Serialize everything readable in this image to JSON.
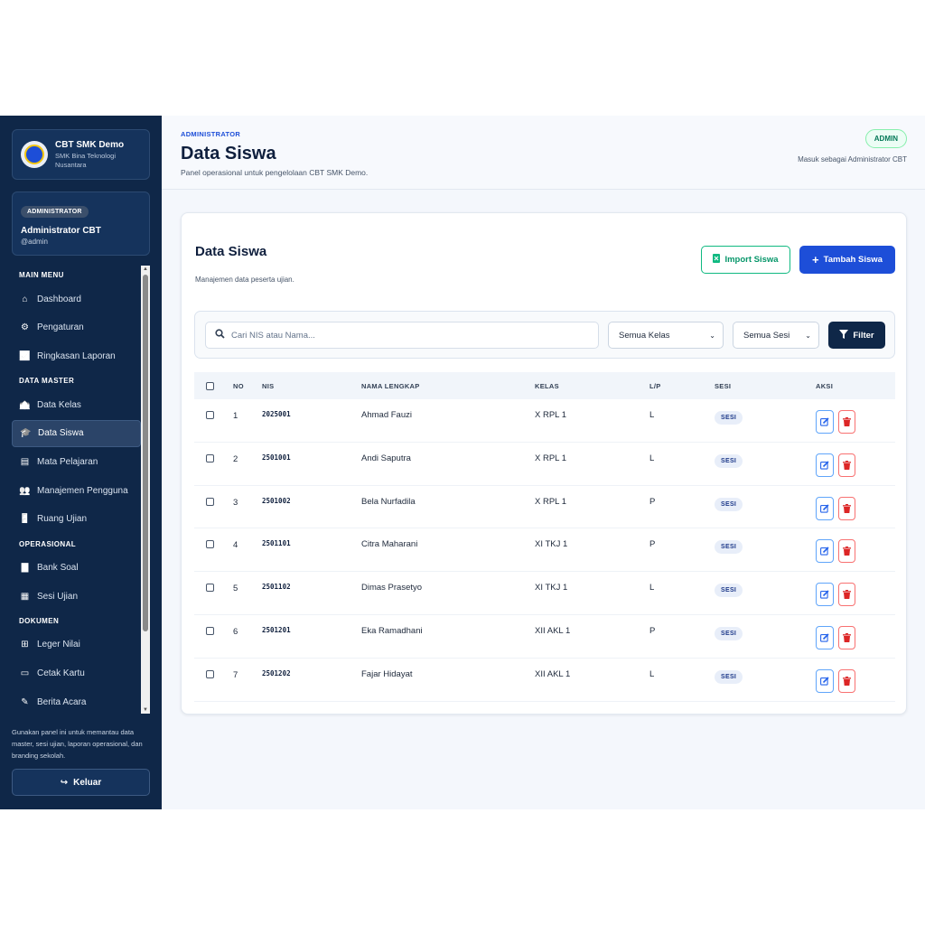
{
  "colors": {
    "sidebar_bg": "#0f2748",
    "primary": "#1d4ed8",
    "success": "#10b981",
    "danger": "#dc2626"
  },
  "sidebar": {
    "brand_title": "CBT SMK Demo",
    "brand_subtitle": "SMK Bina Teknologi Nusantara",
    "role_badge": "ADMINISTRATOR",
    "user_name": "Administrator CBT",
    "user_handle": "@admin",
    "sections": [
      {
        "title": "MAIN MENU",
        "items": [
          {
            "label": "Dashboard",
            "icon": "home-icon"
          },
          {
            "label": "Pengaturan",
            "icon": "gear-icon"
          },
          {
            "label": "Ringkasan Laporan",
            "icon": "chart-line-icon"
          }
        ]
      },
      {
        "title": "DATA MASTER",
        "items": [
          {
            "label": "Data Kelas",
            "icon": "school-icon"
          },
          {
            "label": "Data Siswa",
            "icon": "user-graduate-icon",
            "active": true
          },
          {
            "label": "Mata Pelajaran",
            "icon": "book-icon"
          },
          {
            "label": "Manajemen Pengguna",
            "icon": "users-icon"
          },
          {
            "label": "Ruang Ujian",
            "icon": "door-icon"
          }
        ]
      },
      {
        "title": "OPERASIONAL",
        "items": [
          {
            "label": "Bank Soal",
            "icon": "file-icon"
          },
          {
            "label": "Sesi Ujian",
            "icon": "calendar-icon"
          }
        ]
      },
      {
        "title": "DOKUMEN",
        "items": [
          {
            "label": "Leger Nilai",
            "icon": "table-icon"
          },
          {
            "label": "Cetak Kartu",
            "icon": "id-card-icon"
          },
          {
            "label": "Berita Acara",
            "icon": "signature-icon"
          }
        ]
      }
    ],
    "note": "Gunakan panel ini untuk memantau data master, sesi ujian, laporan operasional, dan branding sekolah.",
    "logout_label": "Keluar"
  },
  "header": {
    "overline": "ADMINISTRATOR",
    "title": "Data Siswa",
    "description": "Panel operasional untuk pengelolaan CBT SMK Demo.",
    "badge": "ADMIN",
    "login_as": "Masuk sebagai Administrator CBT"
  },
  "card": {
    "title": "Data Siswa",
    "description": "Manajemen data peserta ujian.",
    "import_label": "Import Siswa",
    "add_label": "Tambah Siswa"
  },
  "filters": {
    "search_placeholder": "Cari NIS atau Nama...",
    "kelas_selected": "Semua Kelas",
    "sesi_selected": "Semua Sesi",
    "filter_label": "Filter"
  },
  "table": {
    "headers": {
      "no": "NO",
      "nis": "NIS",
      "nama": "NAMA LENGKAP",
      "kelas": "KELAS",
      "lp": "L/P",
      "sesi": "SESI",
      "aksi": "AKSI"
    },
    "rows": [
      {
        "no": "1",
        "nis": "2025001",
        "nama": "Ahmad Fauzi",
        "kelas": "X RPL 1",
        "lp": "L",
        "sesi": "SESI"
      },
      {
        "no": "2",
        "nis": "2501001",
        "nama": "Andi Saputra",
        "kelas": "X RPL 1",
        "lp": "L",
        "sesi": "SESI"
      },
      {
        "no": "3",
        "nis": "2501002",
        "nama": "Bela Nurfadila",
        "kelas": "X RPL 1",
        "lp": "P",
        "sesi": "SESI"
      },
      {
        "no": "4",
        "nis": "2501101",
        "nama": "Citra Maharani",
        "kelas": "XI TKJ 1",
        "lp": "P",
        "sesi": "SESI"
      },
      {
        "no": "5",
        "nis": "2501102",
        "nama": "Dimas Prasetyo",
        "kelas": "XI TKJ 1",
        "lp": "L",
        "sesi": "SESI"
      },
      {
        "no": "6",
        "nis": "2501201",
        "nama": "Eka Ramadhani",
        "kelas": "XII AKL 1",
        "lp": "P",
        "sesi": "SESI"
      },
      {
        "no": "7",
        "nis": "2501202",
        "nama": "Fajar Hidayat",
        "kelas": "XII AKL 1",
        "lp": "L",
        "sesi": "SESI"
      }
    ]
  }
}
